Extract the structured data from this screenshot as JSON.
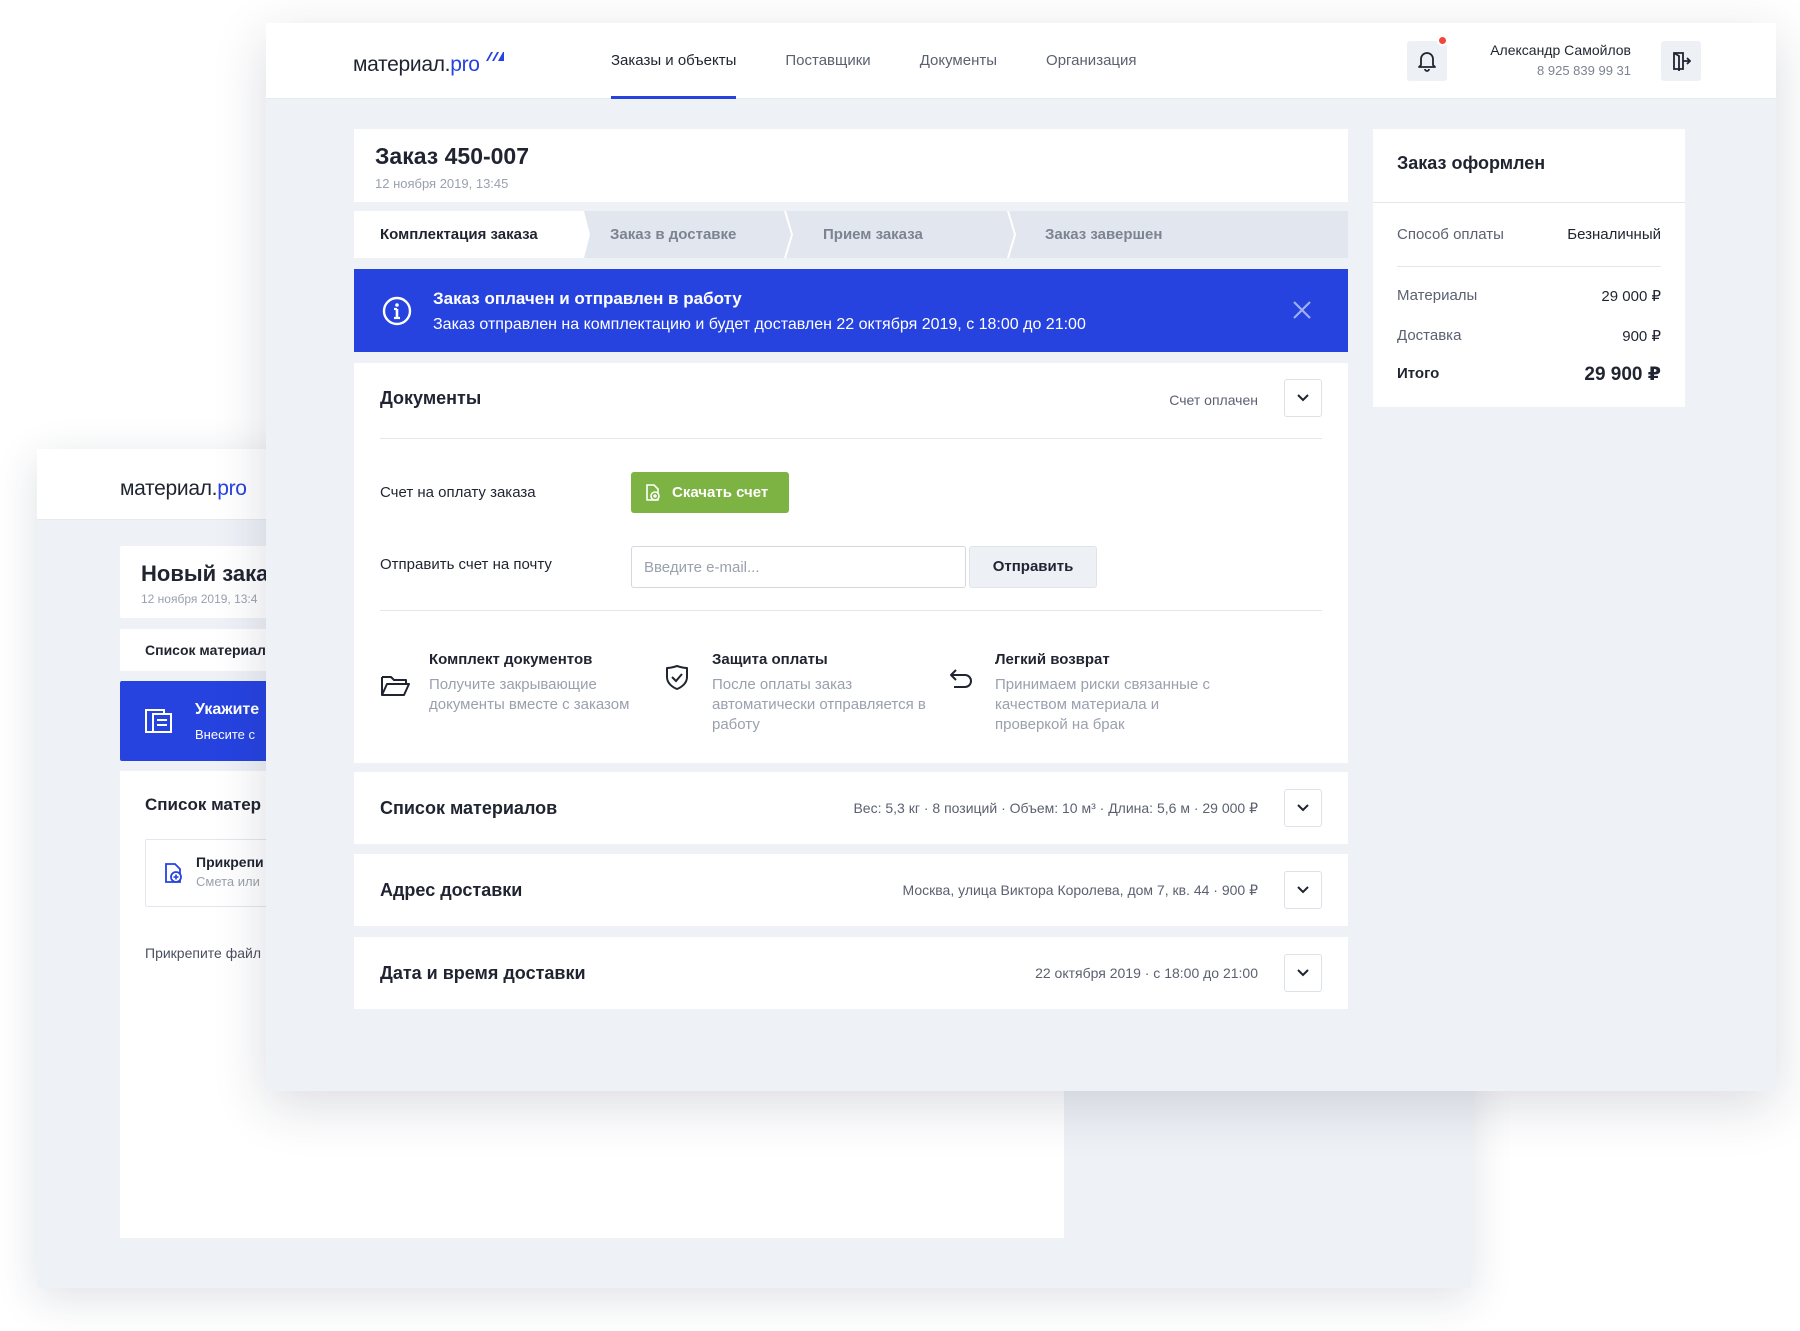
{
  "back": {
    "logo_main": "материал.",
    "logo_pro": "pro",
    "order_title": "Новый зака",
    "order_date": "12 ноября 2019, 13:4",
    "tab_label": "Список материал",
    "banner_title": "Укажите",
    "banner_text": "Внесите с",
    "section_title": "Список матер",
    "attach_title": "Прикрепи",
    "attach_sub": "Смета или",
    "note": "Прикрепите файл"
  },
  "header": {
    "logo_main": "материал.",
    "logo_pro": "pro",
    "nav": [
      {
        "label": "Заказы и объекты",
        "active": true
      },
      {
        "label": "Поставщики",
        "active": false
      },
      {
        "label": "Документы",
        "active": false
      },
      {
        "label": "Организация",
        "active": false
      }
    ],
    "user_name": "Александр Самойлов",
    "user_phone": "8 925 839 99 31"
  },
  "order": {
    "title": "Заказ 450-007",
    "date": "12 ноября 2019, 13:45"
  },
  "steps": [
    {
      "label": "Комплектация заказа"
    },
    {
      "label": "Заказ в доставке"
    },
    {
      "label": "Прием заказа"
    },
    {
      "label": "Заказ завершен"
    }
  ],
  "alert": {
    "title": "Заказ оплачен и отправлен в работу",
    "text": "Заказ отправлен на комплектацию и будет доставлен 22 октября 2019, с 18:00 до 21:00"
  },
  "documents": {
    "title": "Документы",
    "status": "Счет оплачен",
    "invoice_label": "Счет на оплату заказа",
    "download_label": "Скачать счет",
    "email_label": "Отправить счет на почту",
    "email_placeholder": "Введите e-mail...",
    "send_label": "Отправить",
    "features": [
      {
        "title": "Комплект документов",
        "desc": "Получите закрывающие документы вместе с заказом",
        "icon": "folder-icon"
      },
      {
        "title": "Защита оплаты",
        "desc": "После оплаты заказ автоматически отправляется в работу",
        "icon": "shield-check-icon"
      },
      {
        "title": "Легкий возврат",
        "desc": "Принимаем риски связанные с качеством материала и проверкой на брак",
        "icon": "return-arrow-icon"
      }
    ]
  },
  "sections": [
    {
      "title": "Список материалов",
      "meta": "Вес: 5,3 кг · 8 позиций · Объем: 10 м³ · Длина: 5,6 м · 29 000 ₽"
    },
    {
      "title": "Адрес доставки",
      "meta": "Москва, улица Виктора Королева, дом 7, кв. 44 · 900 ₽"
    },
    {
      "title": "Дата и время доставки",
      "meta": "22 октября 2019 · с 18:00 до 21:00"
    }
  ],
  "summary": {
    "title": "Заказ оформлен",
    "payment_label": "Способ оплаты",
    "payment_value": "Безналичный",
    "materials_label": "Материалы",
    "materials_value": "29 000 ₽",
    "delivery_label": "Доставка",
    "delivery_value": "900 ₽",
    "total_label": "Итого",
    "total_value": "29 900 ₽"
  },
  "colors": {
    "accent": "#2643e0",
    "success": "#7cb342",
    "notification": "#f2453d",
    "background": "#eef1f6"
  }
}
